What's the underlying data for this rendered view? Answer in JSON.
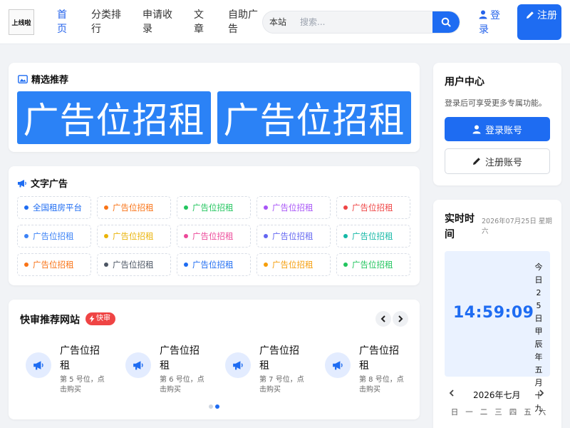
{
  "header": {
    "logo_text": "上线啦",
    "nav": [
      "首页",
      "分类排行",
      "申请收录",
      "文章",
      "自助广告"
    ],
    "search_scope": "本站",
    "search_placeholder": "搜索...",
    "login_label": "登录",
    "register_label": "注册"
  },
  "featured": {
    "title": "精选推荐",
    "ads": [
      "广告位招租",
      "广告位招租"
    ]
  },
  "text_ads": {
    "title": "文字广告",
    "items": [
      {
        "label": "全国租房平台",
        "color": "#1e6cf2"
      },
      {
        "label": "广告位招租",
        "color": "#f97316"
      },
      {
        "label": "广告位招租",
        "color": "#22c55e"
      },
      {
        "label": "广告位招租",
        "color": "#a855f7"
      },
      {
        "label": "广告位招租",
        "color": "#ef4444"
      },
      {
        "label": "广告位招租",
        "color": "#3b82f6"
      },
      {
        "label": "广告位招租",
        "color": "#eab308"
      },
      {
        "label": "广告位招租",
        "color": "#ec4899"
      },
      {
        "label": "广告位招租",
        "color": "#6366f1"
      },
      {
        "label": "广告位招租",
        "color": "#14b8a6"
      },
      {
        "label": "广告位招租",
        "color": "#f97316"
      },
      {
        "label": "广告位招租",
        "color": "#4b5563"
      },
      {
        "label": "广告位招租",
        "color": "#1e6cf2"
      },
      {
        "label": "广告位招租",
        "color": "#f59e0b"
      },
      {
        "label": "广告位招租",
        "color": "#22c55e"
      }
    ]
  },
  "quick_review": {
    "title": "快审推荐网站",
    "badge": "快审",
    "sites": [
      {
        "name": "广告位招租",
        "desc": "第 5 号位，点击购买"
      },
      {
        "name": "广告位招租",
        "desc": "第 6 号位，点击购买"
      },
      {
        "name": "广告位招租",
        "desc": "第 7 号位，点击购买"
      },
      {
        "name": "广告位招租",
        "desc": "第 8 号位，点击购买"
      }
    ],
    "pages": 2,
    "active_page": 2
  },
  "user_center": {
    "title": "用户中心",
    "desc": "登录后可享受更多专属功能。",
    "login_button": "登录账号",
    "register_button": "注册账号"
  },
  "realtime": {
    "title": "实时时间",
    "date": "2026年07月25日 星期六",
    "time": "14:59:09",
    "lunar": "今日25日甲辰年五月十九",
    "calendar_month": "2026年七月",
    "weekdays": [
      "日",
      "一",
      "二",
      "三",
      "四",
      "五",
      "六"
    ]
  },
  "colors": {
    "accent": "#1e6cf2",
    "badge": "#ef4444"
  }
}
